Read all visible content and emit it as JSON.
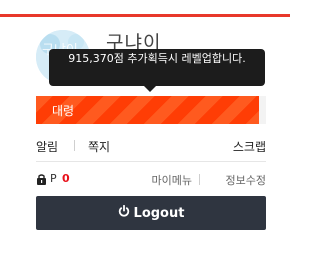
{
  "profile": {
    "username": "구냐이",
    "avatar_icon": "avatar-image"
  },
  "tooltip": {
    "text": "915,370점 추가획득시 레벨업합니다."
  },
  "level": {
    "label": "대령",
    "progress_fraction": 0.97,
    "bar_colors": [
      "#ff5a1f",
      "#ff3d05"
    ]
  },
  "links": {
    "alarm": "알림",
    "note": "쪽지",
    "scrap": "스크랩"
  },
  "points": {
    "icon": "point-bag-icon",
    "letter": "P",
    "value": "0"
  },
  "menu": {
    "my_menu": "마이메뉴",
    "edit_profile": "정보수정"
  },
  "logout": {
    "label": "Logout",
    "icon": "power-icon"
  },
  "colors": {
    "accent": "#e8382a",
    "point_value": "#e8101a",
    "button_bg": "#2f3540"
  }
}
